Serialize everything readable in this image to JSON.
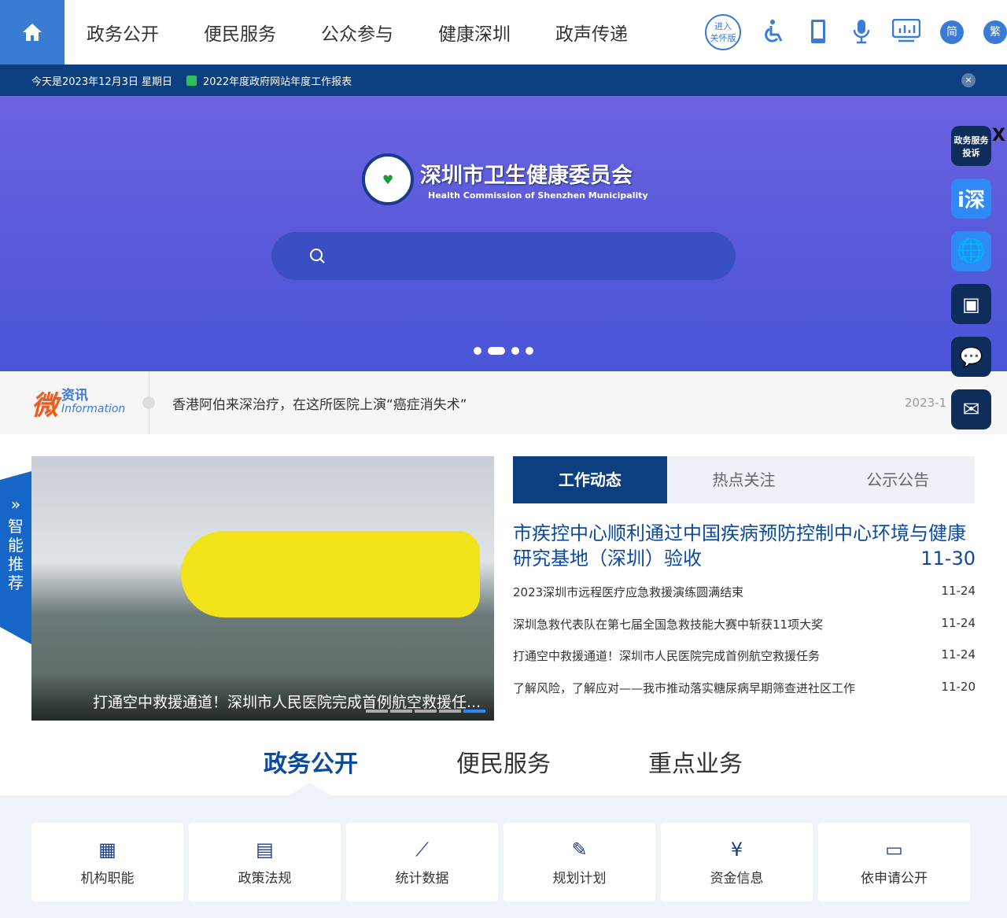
{
  "nav": {
    "items": [
      "政务公开",
      "便民服务",
      "公众参与",
      "健康深圳",
      "政声传递"
    ]
  },
  "tools": {
    "care_line1": "进入",
    "care_line2": "关怀版",
    "simplified": "简",
    "traditional": "繁"
  },
  "bar": {
    "date": "今天是2023年12月3日 星期日",
    "report": "2022年度政府网站年度工作报表",
    "close": "×"
  },
  "hero": {
    "title_cn": "深圳市卫生健康委员会",
    "title_en": "Health Commission of Shenzhen Municipality",
    "emblem": "SZHC"
  },
  "float": {
    "complaint": "政务服务投诉",
    "close": "X"
  },
  "news": {
    "brand": "微",
    "brand_sub": "资讯",
    "brand_en": "Information",
    "headline": "香港阿伯来深治疗，在这所医院上演“癌症消失术”",
    "date": "2023-1"
  },
  "smart": {
    "arrow": "»",
    "label": "智能推荐"
  },
  "slide": {
    "caption": "打通空中救援通道！深圳市人民医院完成首例航空救援任..."
  },
  "tabs": [
    "工作动态",
    "热点关注",
    "公示公告"
  ],
  "headline": {
    "title": "市疾控中心顺利通过中国疾病预防控制中心环境与健康研究基地（深圳）验收",
    "date": "11-30"
  },
  "list": [
    {
      "title": "2023深圳市远程医疗应急救援演练圆满结束",
      "date": "11-24"
    },
    {
      "title": "深圳急救代表队在第七届全国急救技能大赛中斩获11项大奖",
      "date": "11-24"
    },
    {
      "title": "打通空中救援通道！深圳市人民医院完成首例航空救援任务",
      "date": "11-24"
    },
    {
      "title": "了解风险，了解应对——我市推动落实糖尿病早期筛查进社区工作",
      "date": "11-20"
    }
  ],
  "sections": [
    "政务公开",
    "便民服务",
    "重点业务"
  ],
  "cards": [
    "机构职能",
    "政策法规",
    "统计数据",
    "规划计划",
    "资金信息",
    "依申请公开"
  ]
}
